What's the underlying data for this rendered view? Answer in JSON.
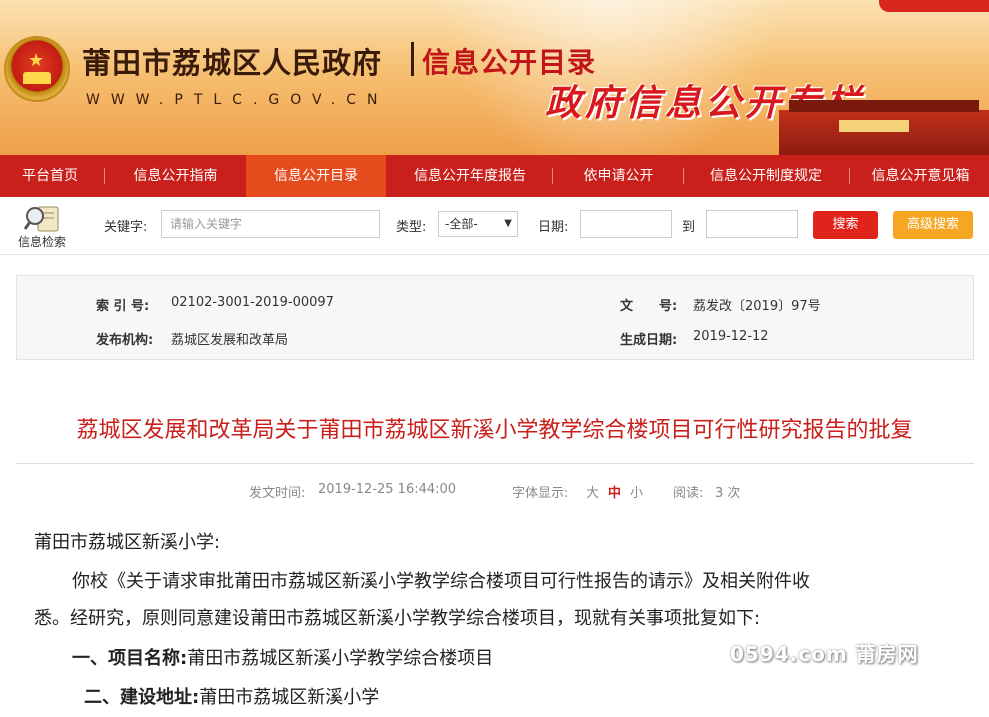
{
  "header": {
    "site_title": "莆田市荔城区人民政府",
    "sub_title": "信息公开目录",
    "url": "WWW.PTLC.GOV.CN",
    "slogan": "政府信息公开专栏"
  },
  "nav": {
    "items": [
      {
        "label": "平台首页",
        "active": false
      },
      {
        "label": "信息公开指南",
        "active": false
      },
      {
        "label": "信息公开目录",
        "active": true
      },
      {
        "label": "信息公开年度报告",
        "active": false
      },
      {
        "label": "依申请公开",
        "active": false
      },
      {
        "label": "信息公开制度规定",
        "active": false
      },
      {
        "label": "信息公开意见箱",
        "active": false
      }
    ]
  },
  "search": {
    "icon_label": "信息检索",
    "keyword_label": "关键字:",
    "keyword_placeholder": "请输入关键字",
    "type_label": "类型:",
    "type_value": "-全部-",
    "date_label": "日期:",
    "date_to_label": "到",
    "search_button": "搜索",
    "advanced_button": "高级搜索"
  },
  "meta": {
    "index_label": "索 引 号:",
    "index_value": "02102-3001-2019-00097",
    "docno_label": "文　　号:",
    "docno_value": "荔发改〔2019〕97号",
    "publisher_label": "发布机构:",
    "publisher_value": "荔城区发展和改革局",
    "date_label": "生成日期:",
    "date_value": "2019-12-12"
  },
  "article": {
    "title": "荔城区发展和改革局关于莆田市荔城区新溪小学教学综合楼项目可行性研究报告的批复",
    "post_time_label": "发文时间:",
    "post_time": "2019-12-25 16:44:00",
    "font_label": "字体显示:",
    "font_large": "大",
    "font_medium": "中",
    "font_small": "小",
    "views_label": "阅读:",
    "views": "3 次",
    "salutation": "莆田市荔城区新溪小学:",
    "para1_line1": "你校《关于请求审批莆田市荔城区新溪小学教学综合楼项目可行性报告的请示》及相关附件收",
    "para1_line2": "悉。经研究，原则同意建设莆田市荔城区新溪小学教学综合楼项目，现就有关事项批复如下:",
    "item1_label": "一、项目名称:",
    "item1_value": "莆田市荔城区新溪小学教学综合楼项目",
    "item2_label": "二、建设地址:",
    "item2_value": "莆田市荔城区新溪小学"
  },
  "watermark": "0594.com 莆房网",
  "colors": {
    "nav_red": "#c9201c",
    "nav_active": "#e64b1e",
    "title_red": "#c9201c",
    "search_btn": "#e0241b",
    "advanced_btn": "#f5a623"
  }
}
